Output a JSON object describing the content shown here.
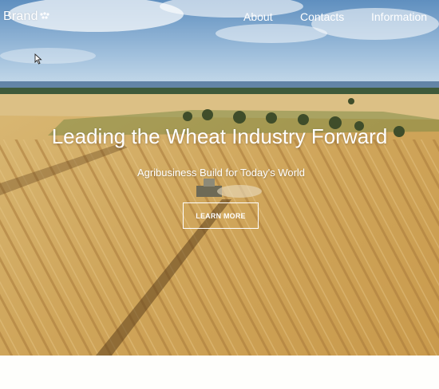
{
  "colors": {
    "sky_top": "#5f8fbf",
    "sky_bottom": "#c9dceb",
    "field_light": "#d9b874",
    "field_dark": "#b8863c",
    "text": "#ffffff",
    "page_bg": "#fdfdfb"
  },
  "header": {
    "brand": "Brand",
    "brand_icon": "brand-logo-icon",
    "nav": [
      {
        "label": "About"
      },
      {
        "label": "Contacts"
      },
      {
        "label": "Information"
      }
    ]
  },
  "hero": {
    "title": "Leading the Wheat Industry Forward",
    "subtitle": "Agribusiness Build for Today's World",
    "cta_label": "LEARN MORE",
    "background_icon": "wheat-field-harvester-image"
  },
  "cursor_icon": "mouse-pointer-icon"
}
